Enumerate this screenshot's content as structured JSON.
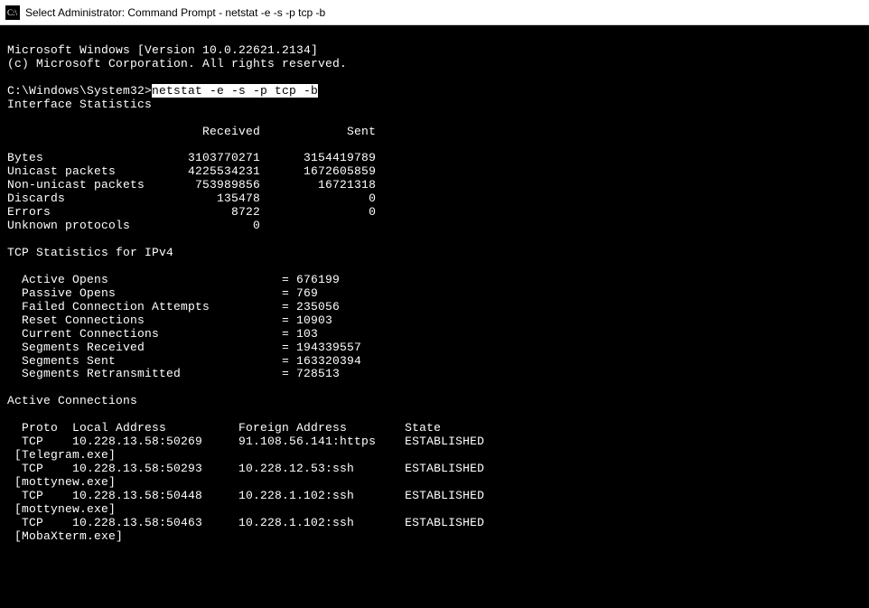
{
  "titlebar": {
    "text": "Select Administrator: Command Prompt - netstat  -e -s -p tcp -b"
  },
  "header": {
    "line1": "Microsoft Windows [Version 10.0.22621.2134]",
    "line2": "(c) Microsoft Corporation. All rights reserved."
  },
  "prompt": {
    "path": "C:\\Windows\\System32>",
    "command": "netstat -e -s -p tcp -b"
  },
  "interface_stats": {
    "title": "Interface Statistics",
    "col_header": "                           Received            Sent",
    "rows": [
      "Bytes                    3103770271      3154419789",
      "Unicast packets          4225534231      1672605859",
      "Non-unicast packets       753989856        16721318",
      "Discards                     135478               0",
      "Errors                         8722               0",
      "Unknown protocols                 0"
    ]
  },
  "tcp_stats": {
    "title": "TCP Statistics for IPv4",
    "rows": [
      "  Active Opens                        = 676199",
      "  Passive Opens                       = 769",
      "  Failed Connection Attempts          = 235056",
      "  Reset Connections                   = 10903",
      "  Current Connections                 = 103",
      "  Segments Received                   = 194339557",
      "  Segments Sent                       = 163320394",
      "  Segments Retransmitted              = 728513"
    ]
  },
  "active_conns": {
    "title": "Active Connections",
    "header": "  Proto  Local Address          Foreign Address        State",
    "rows": [
      "  TCP    10.228.13.58:50269     91.108.56.141:https    ESTABLISHED",
      " [Telegram.exe]",
      "  TCP    10.228.13.58:50293     10.228.12.53:ssh       ESTABLISHED",
      " [mottynew.exe]",
      "  TCP    10.228.13.58:50448     10.228.1.102:ssh       ESTABLISHED",
      " [mottynew.exe]",
      "  TCP    10.228.13.58:50463     10.228.1.102:ssh       ESTABLISHED",
      " [MobaXterm.exe]"
    ]
  }
}
